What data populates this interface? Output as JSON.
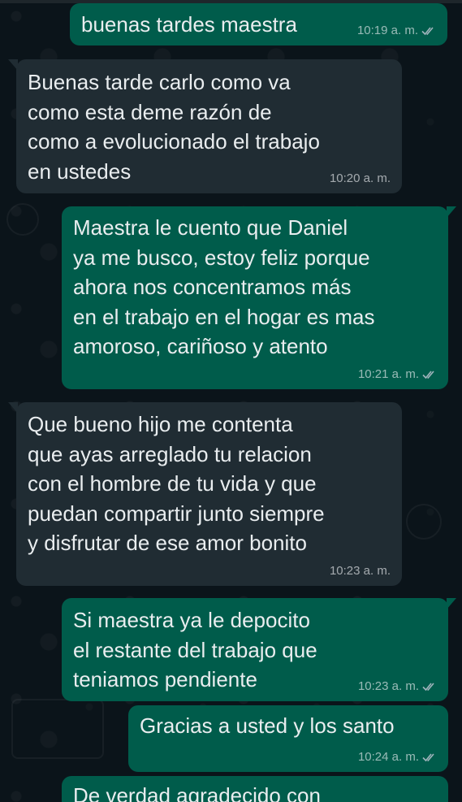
{
  "messages": [
    {
      "direction": "outgoing",
      "text": "buenas tardes maestra",
      "time": "10:19 a. m.",
      "status_icon": "double-check-read-icon"
    },
    {
      "direction": "incoming",
      "text": "Buenas tarde carlo como va\ncomo esta  deme razón  de\ncomo a evolucionado  el trabajo\nen ustedes",
      "time": "10:20 a. m."
    },
    {
      "direction": "outgoing",
      "text": "Maestra le cuento que Daniel\nya me busco, estoy feliz porque\nahora nos concentramos más\nen el trabajo en el hogar es mas\namoroso, cariñoso y atento",
      "time": "10:21 a. m.",
      "status_icon": "double-check-read-icon"
    },
    {
      "direction": "incoming",
      "text": "Que bueno hijo me contenta\nque ayas arreglado tu relacion\ncon el hombre de tu vida y que\npuedan compartir junto siempre\ny disfrutar de ese amor bonito",
      "time": "10:23 a. m."
    },
    {
      "direction": "outgoing",
      "text": "Si maestra ya le depocito\nel restante del trabajo que\nteniamos pendiente",
      "time": "10:23 a. m.",
      "status_icon": "double-check-read-icon"
    },
    {
      "direction": "outgoing",
      "text": "Gracias a usted y los santo",
      "time": "10:24 a. m.",
      "status_icon": "double-check-read-icon"
    },
    {
      "direction": "outgoing",
      "text": "De verdad agradecido con",
      "time": ""
    }
  ],
  "theme": {
    "outgoing_bubble": "#005c4b",
    "incoming_bubble": "#202c33",
    "background": "#0b141a",
    "text": "#e9edef"
  }
}
